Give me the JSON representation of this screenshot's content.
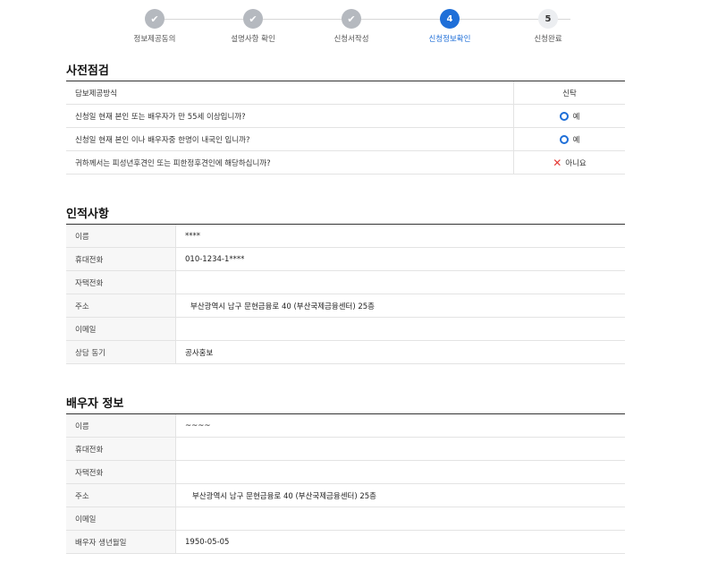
{
  "stepper": {
    "steps": [
      {
        "label": "정보제공동의",
        "state": "done",
        "icon": "check-icon"
      },
      {
        "label": "설명사항 확인",
        "state": "done",
        "icon": "check-icon"
      },
      {
        "label": "신청서작성",
        "state": "done",
        "icon": "check-icon"
      },
      {
        "label": "신청정보확인",
        "state": "active",
        "number": "4"
      },
      {
        "label": "신청완료",
        "state": "todo",
        "number": "5"
      }
    ]
  },
  "precheck": {
    "title": "사전점검",
    "header": {
      "question": "담보제공방식",
      "answer": "신탁"
    },
    "rows": [
      {
        "question": "신청일 현재 본인 또는 배우자가 만 55세 이상입니까?",
        "answer": "예",
        "icon": "circle-o-icon"
      },
      {
        "question": "신청일 현재 본인 이나 배우자중 한명이 내국인 입니까?",
        "answer": "예",
        "icon": "circle-o-icon"
      },
      {
        "question": "귀하께서는 피성년후견인 또는 피한정후견인에 해당하십니까?",
        "answer": "아니요",
        "icon": "x-mark-icon"
      }
    ]
  },
  "personal": {
    "title": "인적사항",
    "rows": [
      {
        "label": "이름",
        "value": "****"
      },
      {
        "label": "휴대전화",
        "value": "010-1234-1****"
      },
      {
        "label": "자택전화",
        "value": ""
      },
      {
        "label": "주소",
        "value": "부산광역시 남구 문현금융로 40 (부산국제금융센터) 25층"
      },
      {
        "label": "이메일",
        "value": ""
      },
      {
        "label": "상담 동기",
        "value": "공사홍보"
      }
    ]
  },
  "spouse": {
    "title": "배우자 정보",
    "rows": [
      {
        "label": "이름",
        "value": "~~~~"
      },
      {
        "label": "휴대전화",
        "value": ""
      },
      {
        "label": "자택전화",
        "value": ""
      },
      {
        "label": "주소",
        "value": "부산광역시 남구 문현금융로 40 (부산국제금융센터) 25층"
      },
      {
        "label": "이메일",
        "value": ""
      },
      {
        "label": "배우자 생년월일",
        "value": "1950-05-05"
      }
    ]
  },
  "colors": {
    "accent": "#1f6fd8",
    "done": "#b5b9bf",
    "no": "#e53935"
  }
}
